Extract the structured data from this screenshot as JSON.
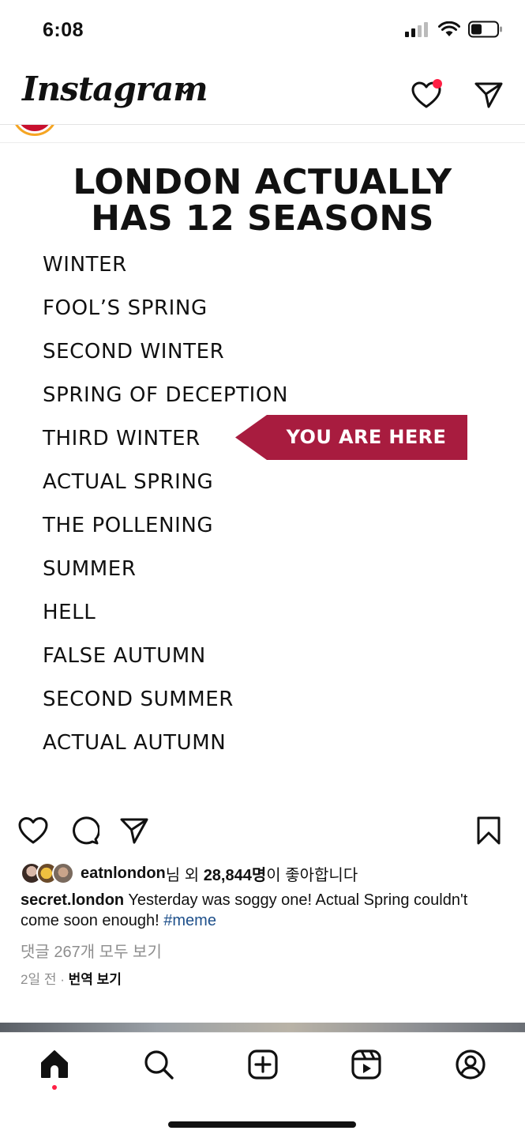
{
  "status_bar": {
    "time": "6:08"
  },
  "header": {
    "logo": "Instagram"
  },
  "post": {
    "image": {
      "title_line1": "LONDON ACTUALLY",
      "title_line2": "HAS 12 SEASONS",
      "seasons": [
        "WINTER",
        "FOOL’S SPRING",
        "SECOND WINTER",
        "SPRING OF DECEPTION",
        "THIRD WINTER",
        "ACTUAL SPRING",
        "THE POLLENING",
        "SUMMER",
        "HELL",
        "FALSE AUTUMN",
        "SECOND SUMMER",
        "ACTUAL AUTUMN"
      ],
      "marker_label": "YOU ARE HERE",
      "marker_color": "#a81c3f"
    },
    "likes": {
      "user": "eatnlondon",
      "text_mid": "님 외 ",
      "count": "28,844명",
      "text_end": "이 좋아합니다"
    },
    "caption": {
      "user": "secret.london",
      "text": " Yesterday was soggy one! Actual Spring couldn't come soon enough! ",
      "hashtag": "#meme"
    },
    "comments_link": "댓글 267개 모두 보기",
    "time_ago": "2일 전",
    "separator": " · ",
    "translate": "번역 보기"
  },
  "colors": {
    "notification": "#ff1f44",
    "hashtag": "#1d4f8a",
    "muted": "#8e8e8e"
  }
}
